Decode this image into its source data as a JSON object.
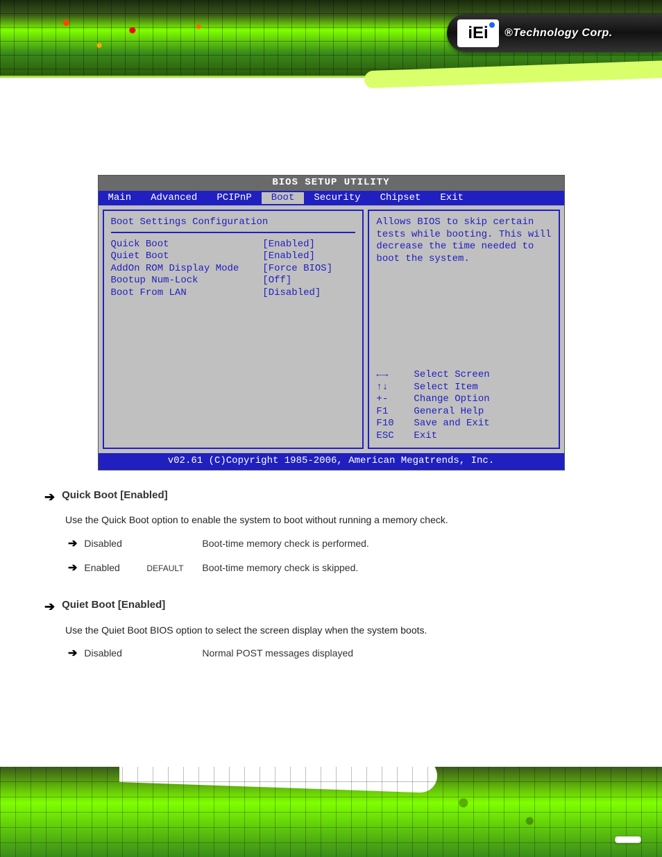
{
  "header": {
    "logo_text": "iEi",
    "brand_text": "®Technology Corp."
  },
  "bios": {
    "title": "BIOS SETUP UTILITY",
    "tabs": [
      "Main",
      "Advanced",
      "PCIPnP",
      "Boot",
      "Security",
      "Chipset",
      "Exit"
    ],
    "active_tab": "Boot",
    "section_title": "Boot Settings Configuration",
    "settings": [
      {
        "label": "Quick Boot",
        "value": "[Enabled]"
      },
      {
        "label": "Quiet Boot",
        "value": "[Enabled]"
      },
      {
        "label": "AddOn ROM Display Mode",
        "value": "[Force BIOS]"
      },
      {
        "label": "Bootup Num-Lock",
        "value": "[Off]"
      },
      {
        "label": "Boot From LAN",
        "value": "[Disabled]"
      }
    ],
    "help_text": "Allows BIOS to skip certain tests while booting. This will decrease the time needed to boot the system.",
    "keys": [
      {
        "k": "←→",
        "d": "Select Screen"
      },
      {
        "k": "↑↓",
        "d": "Select Item"
      },
      {
        "k": "+-",
        "d": "Change Option"
      },
      {
        "k": "F1",
        "d": "General Help"
      },
      {
        "k": "F10",
        "d": "Save and Exit"
      },
      {
        "k": "ESC",
        "d": "Exit"
      }
    ],
    "footer": "v02.61 (C)Copyright 1985-2006, American Megatrends, Inc."
  },
  "doc": {
    "quickboot": {
      "title": "Quick Boot [Enabled]",
      "desc": "Use the Quick Boot option to enable the system to boot without running a memory check.",
      "opts": [
        {
          "key": "Disabled",
          "def": "",
          "desc": "Boot-time memory check is performed."
        },
        {
          "key": "Enabled",
          "def": "DEFAULT",
          "desc": "Boot-time memory check is skipped."
        }
      ]
    },
    "quietboot": {
      "title": "Quiet Boot [Enabled]",
      "desc": "Use the Quiet Boot BIOS option to select the screen display when the system boots.",
      "opts": [
        {
          "key": "Disabled",
          "def": "",
          "desc": "Normal POST messages displayed"
        }
      ]
    }
  },
  "page_number": ""
}
